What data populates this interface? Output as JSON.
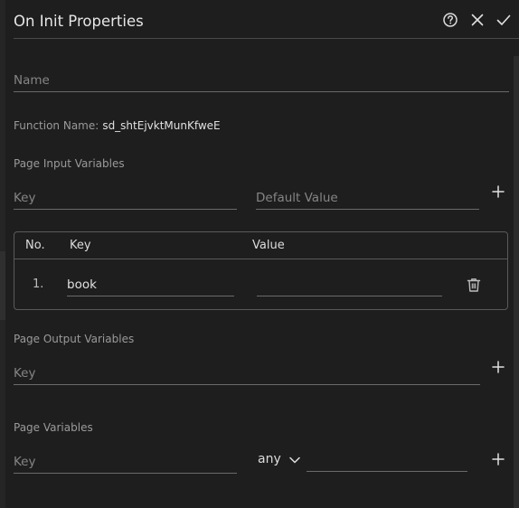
{
  "header": {
    "title": "On Init Properties",
    "icons": [
      "help-circle-icon",
      "close-icon",
      "check-icon"
    ]
  },
  "name_field": {
    "placeholder": "Name",
    "value": ""
  },
  "function_name": {
    "label": "Function Name:",
    "value": "sd_shtEjvktMunKfweE"
  },
  "page_input": {
    "label": "Page Input Variables",
    "key_placeholder": "Key",
    "default_placeholder": "Default Value",
    "add_icon": "plus-icon",
    "table": {
      "columns": [
        "No.",
        "Key",
        "Value"
      ],
      "rows": [
        {
          "no": "1.",
          "key": "book",
          "value": ""
        }
      ],
      "delete_icon": "trash-icon"
    }
  },
  "page_output": {
    "label": "Page Output Variables",
    "key_placeholder": "Key",
    "add_icon": "plus-icon"
  },
  "page_variables": {
    "label": "Page Variables",
    "key_placeholder": "Key",
    "type_selected": "any",
    "value": "",
    "add_icon": "plus-icon"
  },
  "colors": {
    "background": "#1e1e1e",
    "text": "#d6d6d6",
    "muted": "#858585",
    "border": "#5a5a5a"
  }
}
